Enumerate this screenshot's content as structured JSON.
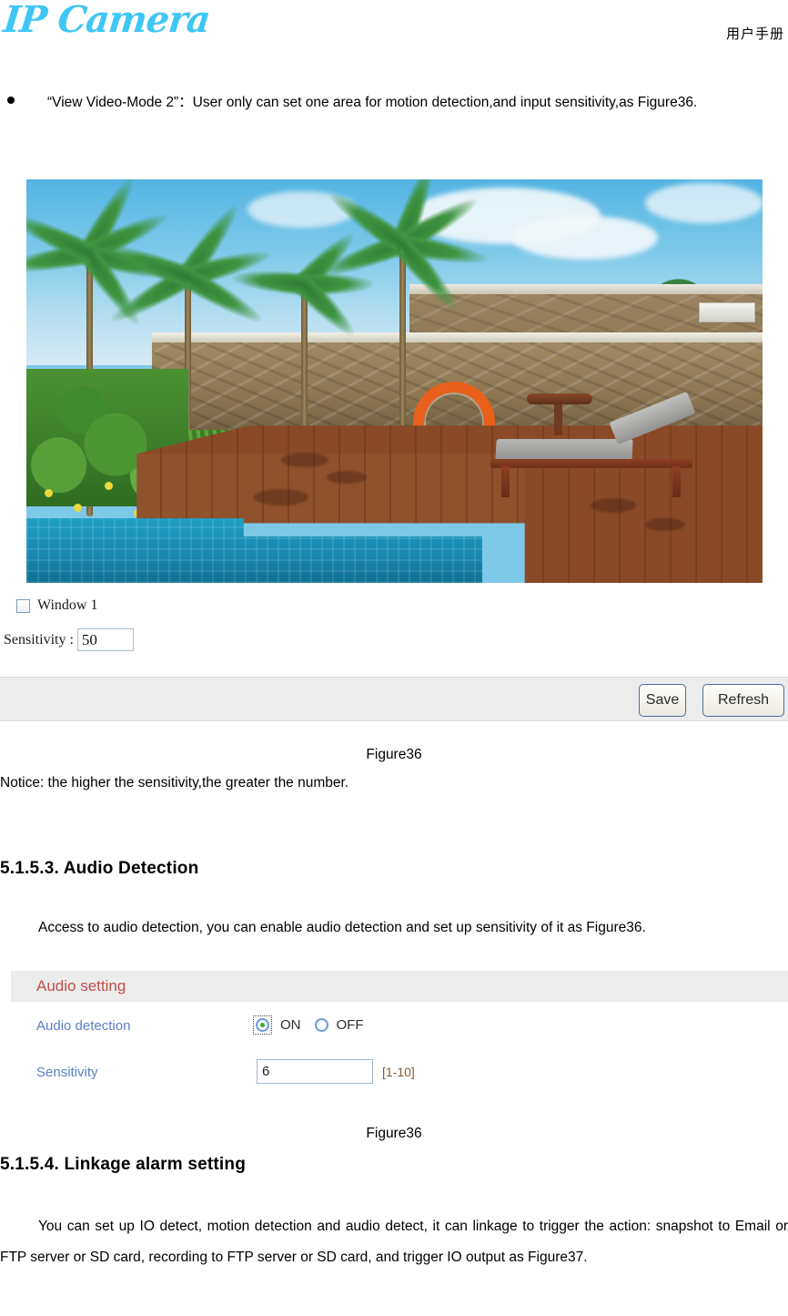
{
  "header": {
    "logo_text": "IP Camera",
    "manual_label": "用户手册"
  },
  "bullet": {
    "text": "“View Video-Mode 2”：User only can set one area for motion detection,and input sensitivity,as Figure36."
  },
  "preview_panel": {
    "window_checkbox_label": "Window 1",
    "window_checked": false,
    "sensitivity_label": "Sensitivity :",
    "sensitivity_value": "50",
    "buttons": {
      "save": "Save",
      "refresh": "Refresh"
    },
    "video_scene_description": "poolside scene with palm trees, stone wall, orange life ring, wooden deck, lounge chair and swimming pool"
  },
  "figure_caption_1": "Figure36",
  "notice": "Notice: the higher the sensitivity,the greater the number.",
  "section_audio": {
    "heading": "5.1.5.3. Audio Detection",
    "paragraph": "Access to audio detection, you can enable audio detection and set up sensitivity of it as Figure36."
  },
  "audio_panel": {
    "panel_title": "Audio setting",
    "detection_label": "Audio detection",
    "radio_on_label": "ON",
    "radio_off_label": "OFF",
    "detection_value": "ON",
    "sensitivity_label": "Sensitivity",
    "sensitivity_value": "6",
    "sensitivity_range_hint": "[1-10]"
  },
  "figure_caption_2": "Figure36",
  "section_linkage": {
    "heading": "5.1.5.4. Linkage alarm setting",
    "paragraph": "You can set up IO detect, motion detection and audio detect, it can linkage to trigger the action: snapshot to Email or FTP server or SD card, recording to FTP server or SD card, and trigger IO output as Figure37."
  },
  "colors": {
    "logo": "#3FC6F4",
    "panel_title": "#c0504d",
    "field_label": "#5b7fc7",
    "hint": "#8a5a34",
    "toolbar_bg": "#ececec",
    "radio_active": "#3fa52f"
  }
}
